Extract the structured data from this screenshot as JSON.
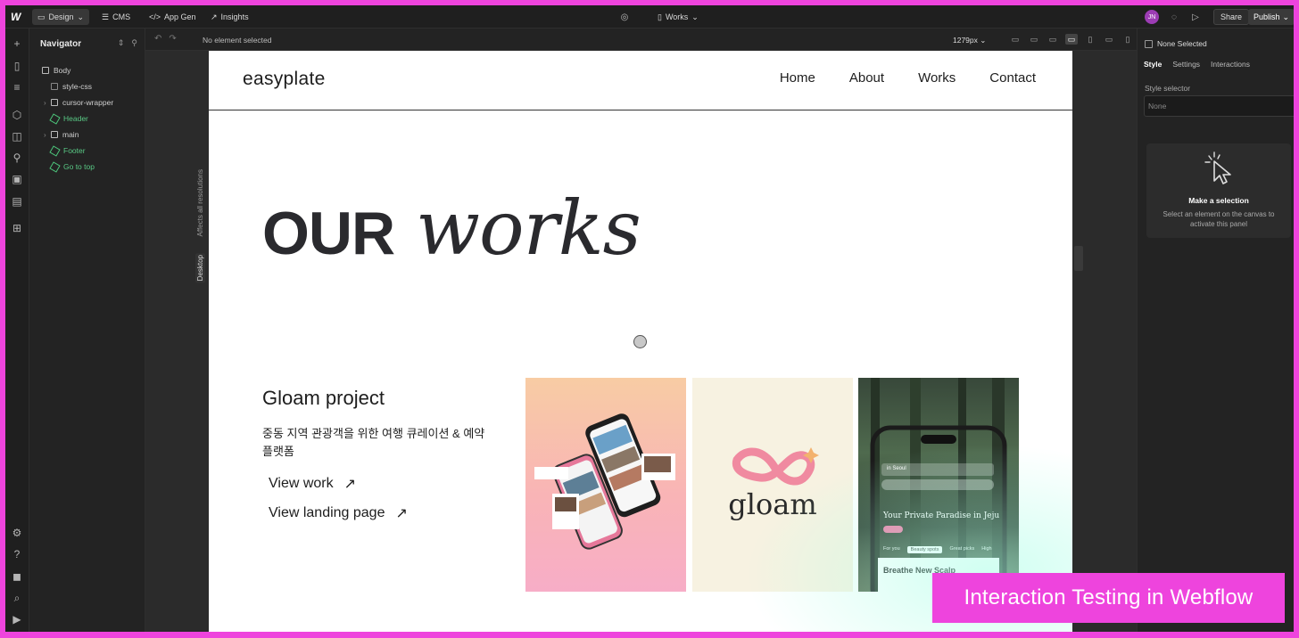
{
  "topbar": {
    "design_label": "Design",
    "cms_label": "CMS",
    "appgen_label": "App Gen",
    "insights_label": "Insights",
    "page_label": "Works",
    "avatar_initials": "JN",
    "share_label": "Share",
    "publish_label": "Publish"
  },
  "navigator": {
    "title": "Navigator",
    "items": [
      {
        "label": "Body"
      },
      {
        "label": "style-css"
      },
      {
        "label": "cursor-wrapper"
      },
      {
        "label": "Header"
      },
      {
        "label": "main"
      },
      {
        "label": "Footer"
      },
      {
        "label": "Go to top"
      }
    ]
  },
  "canvas": {
    "status": "No element selected",
    "width_label": "1279px",
    "affects_label": "Affects all resolutions",
    "desktop_label": "Desktop"
  },
  "site": {
    "brand": "easyplate",
    "menu": [
      "Home",
      "About",
      "Works",
      "Contact"
    ],
    "hero_our": "OUR",
    "hero_works": "works",
    "project_title": "Gloam project",
    "project_desc": "중동 지역 관광객을 위한 여행 큐레이션 & 예약 플랫폼",
    "link_work": "View work",
    "link_landing": "View landing page",
    "gloam_logo": "gloam",
    "phone_location": "in Seoul",
    "phone_headline": "Your Private Paradise in Jeju",
    "phone_tabs": [
      "For you",
      "Beauty spots",
      "Great picks",
      "High"
    ],
    "phone_card_title": "Breathe New Scalp"
  },
  "right_panel": {
    "selection_label": "None Selected",
    "tabs": [
      "Style",
      "Settings",
      "Interactions"
    ],
    "style_selector_label": "Style selector",
    "style_selector_value": "None",
    "empty_title": "Make a selection",
    "empty_desc": "Select an element on the canvas to activate this panel"
  },
  "banner": {
    "text": "Interaction Testing in Webflow"
  },
  "colors": {
    "border_accent": "#ee44dd",
    "component_green": "#59c985",
    "editor_bg": "#1e1e1e"
  }
}
